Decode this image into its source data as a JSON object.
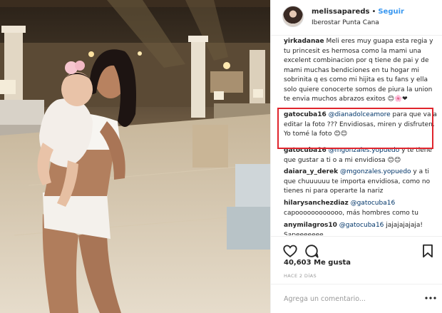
{
  "header": {
    "username": "melissapareds",
    "separator": "•",
    "follow_label": "Seguir",
    "location": "Iberostar Punta Cana"
  },
  "comments": [
    {
      "user": "yirkadanae",
      "text": "Meli eres muy guapa esta regia y tu princesit es hermosa como la mami una excelent combinacion por q tiene de pai y de mami muchas bendiciones en tu hogar mi sobrinita q es como mi hijita es tu fans y ella solo quiere conocerte somos de piura la union te envia muchos abrazos exitos 😊🌸❤"
    },
    {
      "user": "gatocuba16",
      "mention": "@dianadolceamore",
      "text": "para que va a editar la foto ??? Envidiosas, miren y disfruten. Yo tomé la foto 😊😊"
    },
    {
      "user": "gatocuba16",
      "mention": "@mgonzales.yopuedo",
      "text": "y te tiene que gustar a ti o a mi envidiosa 😊😊"
    },
    {
      "user": "daiara_y_derek",
      "mention": "@mgonzales.yopuedo",
      "text": "y a ti que chuuuuuu te importa envidiosa, como no tienes ni para operarte la nariz"
    },
    {
      "user": "hilarysanchezdiaz",
      "mention": "@gatocuba16",
      "text": "capoooooooooooo, más hombres como tu"
    },
    {
      "user": "anymilagros10",
      "mention": "@gatocuba16",
      "text": "jajajajajaja! Sapeeeeeee"
    }
  ],
  "actions": {
    "like_icon": "heart-outline-icon",
    "comment_icon": "comment-bubble-icon",
    "save_icon": "bookmark-icon"
  },
  "likes": "40,603 Me gusta",
  "time_ago": "HACE 2 DÍAS",
  "comment_input": {
    "placeholder": "Agrega un comentario...",
    "value": ""
  },
  "more_icon": "more-options-icon",
  "colors": {
    "follow": "#3897f0",
    "mention": "#003569",
    "highlight": "#e0252d",
    "border": "#efefef"
  }
}
